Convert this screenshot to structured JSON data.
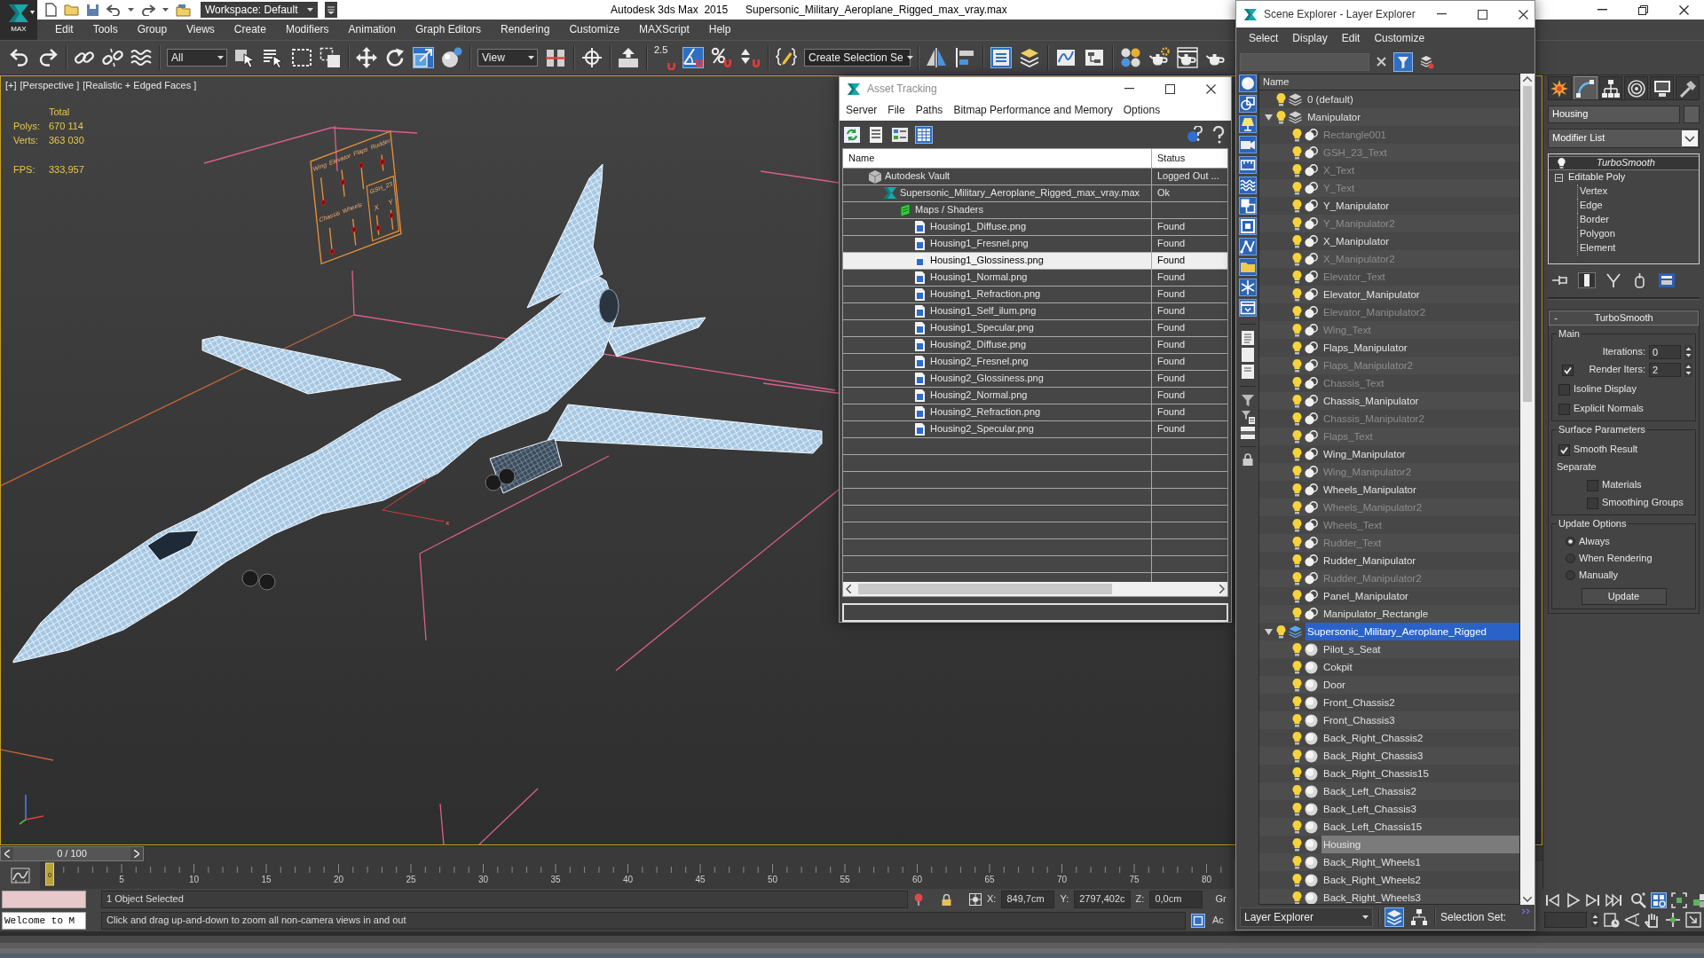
{
  "app_button": {
    "label": "MAX"
  },
  "title_bar": {
    "workspace": "Workspace: Default",
    "app_name": "Autodesk 3ds Max  2015",
    "file_name": "Supersonic_Military_Aeroplane_Rigged_max_vray.max"
  },
  "menu_bar": [
    "Edit",
    "Tools",
    "Group",
    "Views",
    "Create",
    "Modifiers",
    "Animation",
    "Graph Editors",
    "Rendering",
    "Customize",
    "MAXScript",
    "Help"
  ],
  "main_toolbar": [
    [
      {
        "kind": "undo",
        "on": false
      },
      {
        "kind": "redo",
        "on": false
      }
    ],
    [
      {
        "kind": "link",
        "on": false
      },
      {
        "kind": "unlink",
        "on": false
      },
      {
        "kind": "bind",
        "on": false
      }
    ],
    [
      {
        "kind": "dropdown",
        "value": "All"
      },
      {
        "kind": "select",
        "on": false
      },
      {
        "kind": "selname",
        "on": false
      },
      {
        "kind": "region",
        "on": false
      },
      {
        "kind": "crossing",
        "on": false
      }
    ],
    [
      {
        "kind": "move",
        "on": false
      },
      {
        "kind": "rotate",
        "on": false
      },
      {
        "kind": "scale",
        "on": true
      },
      {
        "kind": "place",
        "on": false
      }
    ],
    [
      {
        "kind": "dropdown",
        "value": "View"
      },
      {
        "kind": "pivot",
        "on": false
      }
    ],
    [
      {
        "kind": "manipulate",
        "on": false
      }
    ],
    [
      {
        "kind": "keyboard",
        "on": false
      }
    ],
    [
      {
        "kind": "snap",
        "label": "2.5",
        "on": false
      },
      {
        "kind": "angle",
        "on": true
      },
      {
        "kind": "percent",
        "on": false
      },
      {
        "kind": "spinner",
        "on": false
      }
    ],
    [
      {
        "kind": "editsets",
        "on": false
      },
      {
        "kind": "combo",
        "value": "Create Selection Se"
      }
    ],
    [
      {
        "kind": "mirror",
        "on": false
      },
      {
        "kind": "align",
        "on": false
      }
    ],
    [
      {
        "kind": "explorer",
        "on": true
      },
      {
        "kind": "layers",
        "on": false
      }
    ],
    [
      {
        "kind": "curves",
        "on": false
      },
      {
        "kind": "schematic",
        "on": false
      }
    ],
    [
      {
        "kind": "material",
        "on": false
      },
      {
        "kind": "rendersetup",
        "on": false
      },
      {
        "kind": "framewindow",
        "on": false
      },
      {
        "kind": "render",
        "on": false
      }
    ]
  ],
  "viewport": {
    "menus": [
      "[+]",
      "[Perspective ]",
      "[Realistic + Edged Faces ]"
    ],
    "stats": {
      "heading": "Total",
      "rows": [
        {
          "label": "Polys:",
          "value": "670 114"
        },
        {
          "label": "Verts:",
          "value": "363 030"
        }
      ],
      "fps_label": "FPS:",
      "fps": "333,957"
    },
    "panel_labels": [
      "Wing",
      "Elevator",
      "Flaps",
      "Rudder",
      "Chassis",
      "Wheels",
      "GSH_23",
      "X",
      "Y"
    ],
    "gizmo_axes": [
      "x",
      "y"
    ]
  },
  "time_slider": {
    "position": "0 / 100",
    "level": 0
  },
  "track_bar": {
    "marker": "0",
    "labels": [
      "5",
      "10",
      "15",
      "20",
      "25",
      "30",
      "35",
      "40",
      "45",
      "50",
      "55",
      "60",
      "65",
      "70",
      "75",
      "80"
    ]
  },
  "status_bar": {
    "selection": "1 Object Selected",
    "coordinates": [
      {
        "axis": "X:",
        "value": "849,7cm"
      },
      {
        "axis": "Y:",
        "value": "2797,402c"
      },
      {
        "axis": "Z:",
        "value": "0,0cm"
      }
    ],
    "grid_label": "Gr",
    "listener_output": "Welcome to M",
    "prompt": "Click and drag up-and-down to zoom all non-camera views in and out",
    "time_tag_label": "Ac"
  },
  "navigation": [
    {
      "on": false
    },
    {
      "on": false
    },
    {
      "on": false
    },
    {
      "on": false
    },
    {
      "on": false
    },
    {
      "on": true
    },
    {
      "on": false
    },
    {
      "on": false
    },
    {
      "on": false
    },
    {
      "on": false
    },
    {
      "on": false
    },
    {
      "on": false
    },
    {
      "on": false
    }
  ],
  "command_panel": {
    "tabs": [
      {
        "selected": false
      },
      {
        "selected": true
      },
      {
        "selected": false
      },
      {
        "selected": false
      },
      {
        "selected": false
      },
      {
        "selected": false
      }
    ],
    "object_name": "Housing",
    "modifier_list": "Modifier List",
    "stack": [
      {
        "name": "TurboSmooth",
        "kind": "modifier",
        "selected": true,
        "renderer_only": true
      },
      {
        "name": "Editable Poly",
        "kind": "base",
        "selected": false,
        "expanded": true,
        "children": [
          {
            "name": "Vertex",
            "selected": false
          },
          {
            "name": "Edge",
            "selected": false
          },
          {
            "name": "Border",
            "selected": false
          },
          {
            "name": "Polygon",
            "selected": false
          },
          {
            "name": "Element",
            "selected": false
          }
        ]
      }
    ],
    "stack_buttons": [
      {
        "on": false
      },
      {
        "on": true
      },
      {
        "on": false
      },
      {
        "on": false
      },
      {
        "on": false
      }
    ],
    "rollout": {
      "toggle": "-",
      "title": "TurboSmooth",
      "groups": [
        {
          "title": "Main",
          "controls": [
            {
              "kind": "spinner",
              "label": "Iterations:",
              "value": "0"
            },
            {
              "kind": "checkspinner",
              "label": "Render Iters:",
              "value": "2",
              "checked": true
            },
            {
              "kind": "checkbox",
              "label": "Isoline Display",
              "checked": false
            },
            {
              "kind": "checkbox",
              "label": "Explicit Normals",
              "checked": false
            }
          ]
        },
        {
          "title": "Surface Parameters",
          "controls": [
            {
              "kind": "checkbox",
              "label": "Smooth Result",
              "checked": true
            },
            {
              "kind": "label",
              "label": "Separate"
            },
            {
              "kind": "subcheckbox",
              "label": "Materials",
              "checked": false
            },
            {
              "kind": "subcheckbox",
              "label": "Smoothing Groups",
              "checked": false
            }
          ]
        },
        {
          "title": "Update Options",
          "controls": [
            {
              "kind": "radio",
              "label": "Always",
              "selected": true
            },
            {
              "kind": "radio",
              "label": "When Rendering",
              "selected": false
            },
            {
              "kind": "radio",
              "label": "Manually",
              "selected": false
            },
            {
              "kind": "button",
              "label": "Update"
            }
          ]
        }
      ]
    }
  },
  "asset_tracking": {
    "title": "Asset Tracking",
    "menu": [
      "Server",
      "File",
      "Paths",
      "Bitmap Performance and Memory",
      "Options"
    ],
    "toolbar": [
      {
        "on": false
      },
      {
        "on": false
      },
      {
        "on": false
      },
      {
        "on": true
      }
    ],
    "columns": [
      "Name",
      "Status"
    ],
    "tree": [
      {
        "name": "Autodesk Vault",
        "status": "Logged Out ...",
        "kind": "vault",
        "selected": false,
        "children": [
          {
            "name": "Supersonic_Military_Aeroplane_Rigged_max_vray.max",
            "status": "Ok",
            "kind": "scene",
            "selected": false,
            "children": [
              {
                "name": "Maps / Shaders",
                "kind": "maps",
                "selected": false,
                "children": [
                  {
                    "name": "Housing1_Diffuse.png",
                    "status": "Found",
                    "kind": "bitmap",
                    "selected": false
                  },
                  {
                    "name": "Housing1_Fresnel.png",
                    "status": "Found",
                    "kind": "bitmap",
                    "selected": false
                  },
                  {
                    "name": "Housing1_Glossiness.png",
                    "status": "Found",
                    "kind": "bitmap",
                    "selected": true
                  },
                  {
                    "name": "Housing1_Normal.png",
                    "status": "Found",
                    "kind": "bitmap",
                    "selected": false
                  },
                  {
                    "name": "Housing1_Refraction.png",
                    "status": "Found",
                    "kind": "bitmap",
                    "selected": false
                  },
                  {
                    "name": "Housing1_Self_ilum.png",
                    "status": "Found",
                    "kind": "bitmap",
                    "selected": false
                  },
                  {
                    "name": "Housing1_Specular.png",
                    "status": "Found",
                    "kind": "bitmap",
                    "selected": false
                  },
                  {
                    "name": "Housing2_Diffuse.png",
                    "status": "Found",
                    "kind": "bitmap",
                    "selected": false
                  },
                  {
                    "name": "Housing2_Fresnel.png",
                    "status": "Found",
                    "kind": "bitmap",
                    "selected": false
                  },
                  {
                    "name": "Housing2_Glossiness.png",
                    "status": "Found",
                    "kind": "bitmap",
                    "selected": false
                  },
                  {
                    "name": "Housing2_Normal.png",
                    "status": "Found",
                    "kind": "bitmap",
                    "selected": false
                  },
                  {
                    "name": "Housing2_Refraction.png",
                    "status": "Found",
                    "kind": "bitmap",
                    "selected": false
                  },
                  {
                    "name": "Housing2_Specular.png",
                    "status": "Found",
                    "kind": "bitmap",
                    "selected": false
                  }
                ]
              }
            ]
          }
        ]
      }
    ]
  },
  "scene_explorer": {
    "title": "Scene Explorer - Layer Explorer",
    "menu": [
      "Select",
      "Display",
      "Edit",
      "Customize"
    ],
    "search_filter": {
      "on": true
    },
    "display_filters": [
      {
        "on": true
      },
      {
        "on": true
      },
      {
        "on": true
      },
      {
        "on": true
      },
      {
        "on": true
      },
      {
        "on": true
      },
      {
        "on": true
      },
      {
        "on": true
      },
      {
        "on": true
      },
      {
        "on": true
      },
      {
        "on": true
      },
      {
        "on": true
      }
    ],
    "column": "Name",
    "tree": [
      {
        "name": "0 (default)",
        "kind": "layer",
        "active": false,
        "selected": false,
        "frozen": false
      },
      {
        "name": "Manipulator",
        "kind": "layer",
        "active": false,
        "selected": false,
        "frozen": false,
        "expanded": true,
        "children": [
          {
            "name": "Rectangle001",
            "kind": "shape",
            "selected": false,
            "frozen": true
          },
          {
            "name": "GSH_23_Text",
            "kind": "shape",
            "selected": false,
            "frozen": true
          },
          {
            "name": "X_Text",
            "kind": "shape",
            "selected": false,
            "frozen": true
          },
          {
            "name": "Y_Text",
            "kind": "shape",
            "selected": false,
            "frozen": true
          },
          {
            "name": "Y_Manipulator",
            "kind": "shape",
            "selected": false,
            "frozen": false
          },
          {
            "name": "Y_Manipulator2",
            "kind": "shape",
            "selected": false,
            "frozen": true
          },
          {
            "name": "X_Manipulator",
            "kind": "shape",
            "selected": false,
            "frozen": false
          },
          {
            "name": "X_Manipulator2",
            "kind": "shape",
            "selected": false,
            "frozen": true
          },
          {
            "name": "Elevator_Text",
            "kind": "shape",
            "selected": false,
            "frozen": true
          },
          {
            "name": "Elevator_Manipulator",
            "kind": "shape",
            "selected": false,
            "frozen": false
          },
          {
            "name": "Elevator_Manipulator2",
            "kind": "shape",
            "selected": false,
            "frozen": true
          },
          {
            "name": "Wing_Text",
            "kind": "shape",
            "selected": false,
            "frozen": true
          },
          {
            "name": "Flaps_Manipulator",
            "kind": "shape",
            "selected": false,
            "frozen": false
          },
          {
            "name": "Flaps_Manipulator2",
            "kind": "shape",
            "selected": false,
            "frozen": true
          },
          {
            "name": "Chassis_Text",
            "kind": "shape",
            "selected": false,
            "frozen": true
          },
          {
            "name": "Chassis_Manipulator",
            "kind": "shape",
            "selected": false,
            "frozen": false
          },
          {
            "name": "Chassis_Manipulator2",
            "kind": "shape",
            "selected": false,
            "frozen": true
          },
          {
            "name": "Flaps_Text",
            "kind": "shape",
            "selected": false,
            "frozen": true
          },
          {
            "name": "Wing_Manipulator",
            "kind": "shape",
            "selected": false,
            "frozen": false
          },
          {
            "name": "Wing_Manipulator2",
            "kind": "shape",
            "selected": false,
            "frozen": true
          },
          {
            "name": "Wheels_Manipulator",
            "kind": "shape",
            "selected": false,
            "frozen": false
          },
          {
            "name": "Wheels_Manipulator2",
            "kind": "shape",
            "selected": false,
            "frozen": true
          },
          {
            "name": "Wheels_Text",
            "kind": "shape",
            "selected": false,
            "frozen": true
          },
          {
            "name": "Rudder_Text",
            "kind": "shape",
            "selected": false,
            "frozen": true
          },
          {
            "name": "Rudder_Manipulator",
            "kind": "shape",
            "selected": false,
            "frozen": false
          },
          {
            "name": "Rudder_Manipulator2",
            "kind": "shape",
            "selected": false,
            "frozen": true
          },
          {
            "name": "Panel_Manipulator",
            "kind": "shape",
            "selected": false,
            "frozen": false
          },
          {
            "name": "Manipulator_Rectangle",
            "kind": "shape",
            "selected": false,
            "frozen": false
          }
        ]
      },
      {
        "name": "Supersonic_Military_Aeroplane_Rigged",
        "kind": "layer",
        "active": true,
        "selected": true,
        "frozen": false,
        "expanded": true,
        "children": [
          {
            "name": "Pilot_s_Seat",
            "kind": "geometry",
            "selected": false,
            "frozen": false
          },
          {
            "name": "Cokpit",
            "kind": "geometry",
            "selected": false,
            "frozen": false
          },
          {
            "name": "Door",
            "kind": "geometry",
            "selected": false,
            "frozen": false
          },
          {
            "name": "Front_Chassis2",
            "kind": "geometry",
            "selected": false,
            "frozen": false
          },
          {
            "name": "Front_Chassis3",
            "kind": "geometry",
            "selected": false,
            "frozen": false
          },
          {
            "name": "Back_Right_Chassis2",
            "kind": "geometry",
            "selected": false,
            "frozen": false
          },
          {
            "name": "Back_Right_Chassis3",
            "kind": "geometry",
            "selected": false,
            "frozen": false
          },
          {
            "name": "Back_Right_Chassis15",
            "kind": "geometry",
            "selected": false,
            "frozen": false
          },
          {
            "name": "Back_Left_Chassis2",
            "kind": "geometry",
            "selected": false,
            "frozen": false
          },
          {
            "name": "Back_Left_Chassis3",
            "kind": "geometry",
            "selected": false,
            "frozen": false
          },
          {
            "name": "Back_Left_Chassis15",
            "kind": "geometry",
            "selected": false,
            "frozen": false
          },
          {
            "name": "Housing",
            "kind": "geometry",
            "selected": true,
            "frozen": false
          },
          {
            "name": "Back_Right_Wheels1",
            "kind": "geometry",
            "selected": false,
            "frozen": false
          },
          {
            "name": "Back_Right_Wheels2",
            "kind": "geometry",
            "selected": false,
            "frozen": false
          },
          {
            "name": "Back_Right_Wheels3",
            "kind": "geometry",
            "selected": false,
            "frozen": false
          }
        ]
      }
    ],
    "footer": {
      "explorer": "Layer Explorer",
      "modes": [
        {
          "selected": true
        },
        {
          "selected": false
        }
      ],
      "selection_set": "Selection Set:"
    }
  }
}
